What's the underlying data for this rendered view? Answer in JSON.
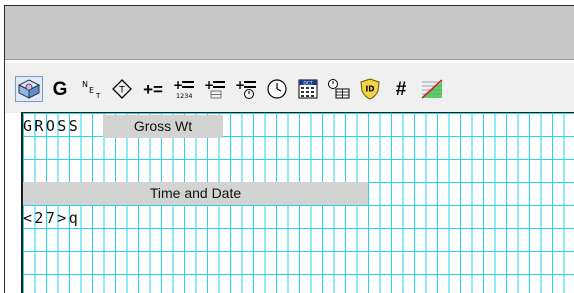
{
  "toolbar": {
    "tools": [
      {
        "icon": "select-cube-icon"
      },
      {
        "text": "G"
      },
      {
        "icon": "net-icon"
      },
      {
        "icon": "tare-diamond-icon"
      },
      {
        "text": "+="
      },
      {
        "icon": "accumulate-1234-icon"
      },
      {
        "icon": "subtotal-icon"
      },
      {
        "icon": "counter-clock-icon"
      },
      {
        "icon": "clock-icon"
      },
      {
        "icon": "dct-table-icon"
      },
      {
        "icon": "time-table-icon"
      },
      {
        "icon": "id-shield-icon"
      },
      {
        "text": "#"
      },
      {
        "icon": "graph-icon"
      }
    ]
  },
  "canvas": {
    "gross_code": "GROSS",
    "gross_label": "Gross Wt",
    "time_label": "Time and Date",
    "code_line": "<27>q"
  },
  "colors": {
    "grid": "#2ad6e6",
    "label_bg": "#d3d3d3"
  }
}
